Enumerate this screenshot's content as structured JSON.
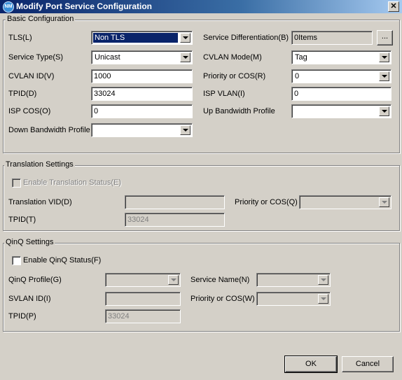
{
  "window": {
    "title": "Modify Port Service Configuration",
    "icon": "app-globe-icon",
    "close": "✕"
  },
  "basic": {
    "legend": "Basic Configuration",
    "tls_label": "TLS(L)",
    "tls_value": "Non TLS",
    "service_type_label": "Service Type(S)",
    "service_type_value": "Unicast",
    "cvlan_id_label": "CVLAN ID(V)",
    "cvlan_id_value": "1000",
    "tpid_label": "TPID(D)",
    "tpid_value": "33024",
    "isp_cos_label": "ISP COS(O)",
    "isp_cos_value": "0",
    "down_bw_label": "Down Bandwidth Profile",
    "down_bw_value": "",
    "service_diff_label": "Service Differentiation(B)",
    "service_diff_value": "0Items",
    "service_diff_button": "...",
    "cvlan_mode_label": "CVLAN Mode(M)",
    "cvlan_mode_value": "Tag",
    "priority_label": "Priority or COS(R)",
    "priority_value": "0",
    "isp_vlan_label": "ISP VLAN(I)",
    "isp_vlan_value": "0",
    "up_bw_label": "Up Bandwidth Profile",
    "up_bw_value": ""
  },
  "translation": {
    "legend": "Translation Settings",
    "enable_label": "Enable Translation Status(E)",
    "vid_label": "Translation VID(D)",
    "vid_value": "",
    "priority_label": "Priority or COS(Q)",
    "priority_value": "",
    "tpid_label": "TPID(T)",
    "tpid_value": "33024"
  },
  "qinq": {
    "legend": "QinQ Settings",
    "enable_label": "Enable QinQ Status(F)",
    "profile_label": "QinQ Profile(G)",
    "profile_value": "",
    "service_name_label": "Service Name(N)",
    "service_name_value": "",
    "svlan_label": "SVLAN ID(I)",
    "svlan_value": "",
    "priority_label": "Priority or COS(W)",
    "priority_value": "",
    "tpid_label": "TPID(P)",
    "tpid_value": "33024"
  },
  "buttons": {
    "ok": "OK",
    "cancel": "Cancel"
  }
}
